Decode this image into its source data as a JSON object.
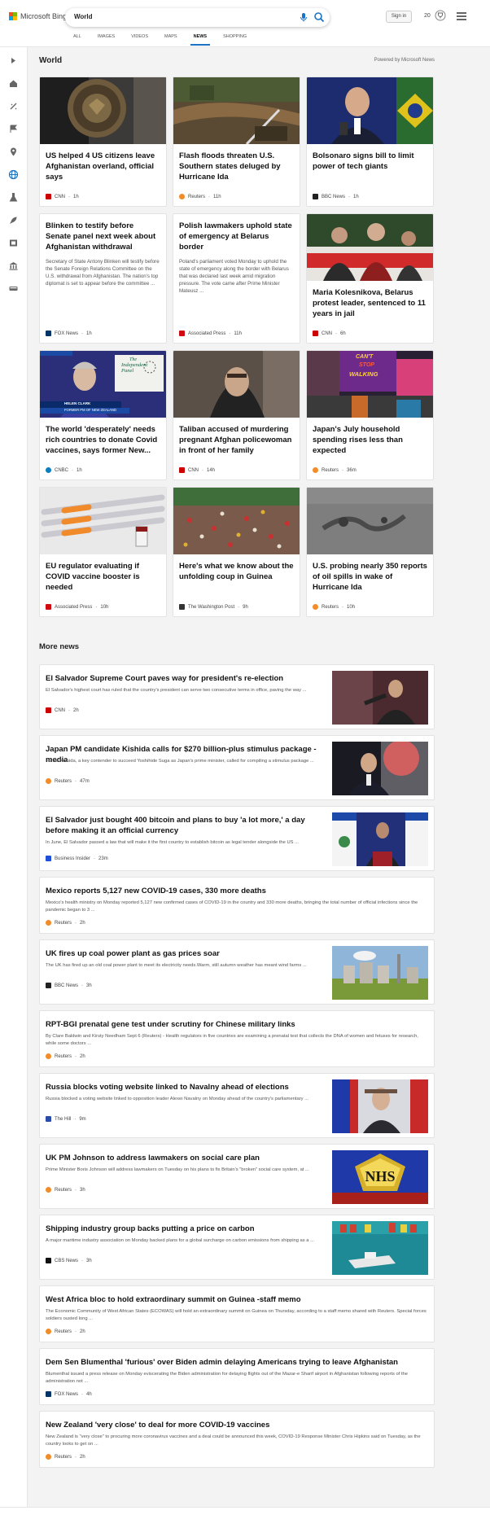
{
  "header": {
    "brand": "Microsoft Bing",
    "query": "World",
    "signin_label": "Sign in",
    "points": "20",
    "scopes": [
      {
        "label": "ALL",
        "active": false
      },
      {
        "label": "IMAGES",
        "active": false
      },
      {
        "label": "VIDEOS",
        "active": false
      },
      {
        "label": "MAPS",
        "active": false
      },
      {
        "label": "NEWS",
        "active": true
      },
      {
        "label": "SHOPPING",
        "active": false
      }
    ]
  },
  "rail": {
    "icons": [
      "expand-icon",
      "home-icon",
      "sparkle-icon",
      "flag-icon",
      "location-pin-icon",
      "globe-icon",
      "flask-icon",
      "rocket-icon",
      "film-icon",
      "bank-icon",
      "car-icon"
    ]
  },
  "section": {
    "title": "World",
    "powered": "Powered by Microsoft News"
  },
  "colors": {
    "accent": "#1b73c6",
    "cnn": "#cc0000",
    "reuters": "#f28c28",
    "bbc": "#222222",
    "fox": "#003366",
    "ap": "#d10a11",
    "cnbc": "#0a7ebf",
    "wapo": "#333333",
    "bi": "#1f4fd8",
    "thehill": "#2b4ba8",
    "cbs": "#111111"
  },
  "cards": [
    {
      "title": "US helped 4 US citizens leave Afghanistan overland, official says",
      "source": "CNN",
      "time": "1h",
      "abstract": ""
    },
    {
      "title": "Flash floods threaten U.S. Southern states deluged by Hurricane Ida",
      "source": "Reuters",
      "time": "11h",
      "abstract": ""
    },
    {
      "title": "Bolsonaro signs bill to limit power of tech giants",
      "source": "BBC News",
      "time": "1h",
      "abstract": ""
    },
    {
      "title": "Blinken to testify before Senate panel next week about Afghanistan withdrawal",
      "source": "FOX News",
      "time": "1h",
      "abstract": "Secretary of State Antony Blinken will testify before the Senate Foreign Relations Committee on the U.S. withdrawal from Afghanistan. The nation's top diplomat is set to appear before the committee ..."
    },
    {
      "title": "Polish lawmakers uphold state of emergency at Belarus border",
      "source": "Associated Press",
      "time": "11h",
      "abstract": "Poland's parliament voted Monday to uphold the state of emergency along the border with Belarus that was declared last week amid migration pressure. The vote came after Prime Minister Mateusz ..."
    },
    {
      "title": "Maria Kolesnikova, Belarus protest leader, sentenced to 11 years in jail",
      "source": "CNN",
      "time": "6h",
      "abstract": ""
    },
    {
      "title": "The world 'desperately' needs rich countries to donate Covid vaccines, says former New...",
      "source": "CNBC",
      "time": "1h",
      "abstract": ""
    },
    {
      "title": "Taliban accused of murdering pregnant Afghan policewoman in front of her family",
      "source": "CNN",
      "time": "14h",
      "abstract": ""
    },
    {
      "title": "Japan's July household spending rises less than expected",
      "source": "Reuters",
      "time": "36m",
      "abstract": ""
    },
    {
      "title": "EU regulator evaluating if COVID vaccine booster is needed",
      "source": "Associated Press",
      "time": "10h",
      "abstract": ""
    },
    {
      "title": "Here's what we know about the unfolding coup in Guinea",
      "source": "The Washington Post",
      "time": "9h",
      "abstract": ""
    },
    {
      "title": "U.S. probing nearly 350 reports of oil spills in wake of Hurricane Ida",
      "source": "Reuters",
      "time": "10h",
      "abstract": ""
    }
  ],
  "card_overlays": {
    "vaccine_banner_1": "HELEN CLARK",
    "vaccine_banner_2": "FORMER PM OF NEW ZEALAND",
    "panel_1": "The",
    "panel_2": "Independent",
    "panel_3": "Panel",
    "neon_1": "CAN'T",
    "neon_2": "STOP",
    "neon_3": "WALKING"
  },
  "more": {
    "title": "More news",
    "items": [
      {
        "title": "El Salvador Supreme Court paves way for president's re-election",
        "snippet": "El Salvador's highest court has ruled that the country's president can serve two consecutive terms in office, paving the way ...",
        "source": "CNN",
        "time": "2h"
      },
      {
        "title": "Japan PM candidate Kishida calls for $270 billion-plus stimulus package -media",
        "snippet": "Fumio Kishida, a key contender to succeed Yoshihide Suga as Japan's prime minister, called for compiling a stimulus package ...",
        "source": "Reuters",
        "time": "47m"
      },
      {
        "title": "El Salvador just bought 400 bitcoin and plans to buy 'a lot more,' a day before making it an official currency",
        "snippet": "In June, El Salvador passed a law that will make it the first country to establish bitcoin as legal tender alongside the US ...",
        "source": "Business Insider",
        "time": "23m"
      },
      {
        "title": "Mexico reports 5,127 new COVID-19 cases, 330 more deaths",
        "snippet": "Mexico's health ministry on Monday reported 5,127 new confirmed cases of COVID-19 in the country and 330 more deaths, bringing the total number of official infections since the pandemic began to 3 ...",
        "source": "Reuters",
        "time": "2h"
      },
      {
        "title": "UK fires up coal power plant as gas prices soar",
        "snippet": "The UK has fired up an old coal power plant to meet its electricity needs.Warm, still autumn weather has meant wind farms ...",
        "source": "BBC News",
        "time": "3h"
      },
      {
        "title": "RPT-BGI prenatal gene test under scrutiny for Chinese military links",
        "snippet": "By Clare Baldwin and Kirsty Needham Sept 6 (Reuters) - Health regulators in five countries are examining a prenatal test that collects the DNA of women and fetuses for research, while some doctors ...",
        "source": "Reuters",
        "time": "2h"
      },
      {
        "title": "Russia blocks voting website linked to Navalny ahead of elections",
        "snippet": "Russia blocked a voting website linked to opposition leader Alexei Navalny on Monday ahead of the country's parliamentary ...",
        "source": "The Hill",
        "time": "9m"
      },
      {
        "title": "UK PM Johnson to address lawmakers on social care plan",
        "snippet": "Prime Minister Boris Johnson will address lawmakers on Tuesday on his plans to fix Britain's \"broken\" social care system, at ...",
        "source": "Reuters",
        "time": "3h"
      },
      {
        "title": "Shipping industry group backs putting a price on carbon",
        "snippet": "A major maritime industry association on Monday backed plans for a global surcharge on carbon emissions from shipping as a ...",
        "source": "CBS News",
        "time": "3h"
      },
      {
        "title": "West Africa bloc to hold extraordinary summit on Guinea -staff memo",
        "snippet": "The Economic Community of West African States (ECOWAS) will hold an extraordinary summit on Guinea on Thursday, according to a staff memo shared with Reuters. Special forces soldiers ousted long ...",
        "source": "Reuters",
        "time": "2h"
      },
      {
        "title": "Dem Sen Blumenthal 'furious' over Biden admin delaying Americans trying to leave Afghanistan",
        "snippet": "Blumenthal issued a press release on Monday eviscerating the Biden administration for delaying flights out of the Mazar-e Sharif airport in Afghanistan following reports of the administration not ...",
        "source": "FOX News",
        "time": "4h"
      },
      {
        "title": "New Zealand 'very close' to deal for more COVID-19 vaccines",
        "snippet": "New Zealand is \"very close\" to procuring more coronavirus vaccines and a deal could be announced this week, COVID-19 Response Minister Chris Hipkins said on Tuesday, as the country looks to get on ...",
        "source": "Reuters",
        "time": "2h"
      }
    ]
  }
}
